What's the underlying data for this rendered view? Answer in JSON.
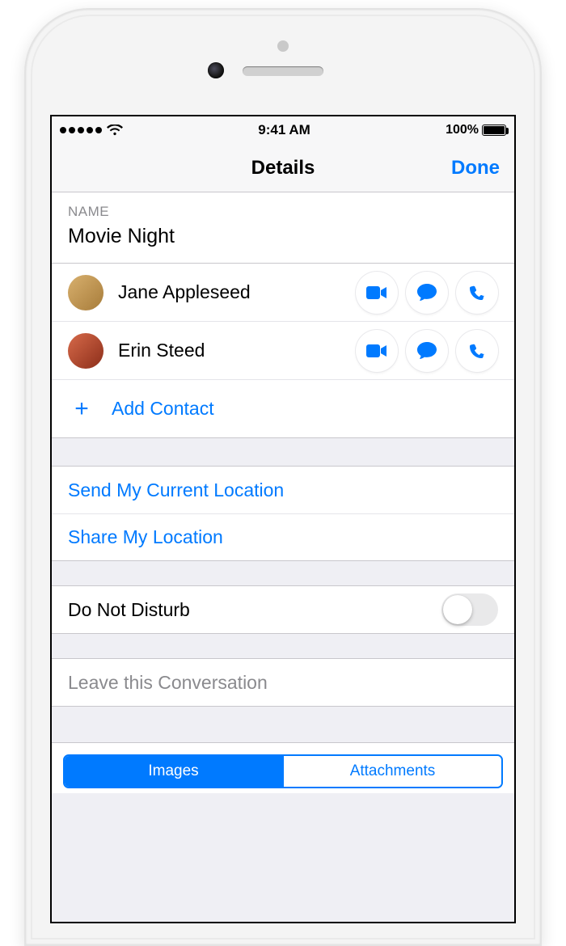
{
  "status": {
    "time": "9:41 AM",
    "battery": "100%"
  },
  "nav": {
    "title": "Details",
    "done": "Done"
  },
  "name": {
    "header": "NAME",
    "value": "Movie Night"
  },
  "contacts": [
    {
      "name": "Jane Appleseed"
    },
    {
      "name": "Erin Steed"
    }
  ],
  "addContact": "Add Contact",
  "location": {
    "send": "Send My Current Location",
    "share": "Share My Location"
  },
  "dnd": "Do Not Disturb",
  "leave": "Leave this Conversation",
  "tabs": {
    "images": "Images",
    "attachments": "Attachments"
  },
  "avatarColors": [
    "#c59a5c",
    "#b54834"
  ]
}
